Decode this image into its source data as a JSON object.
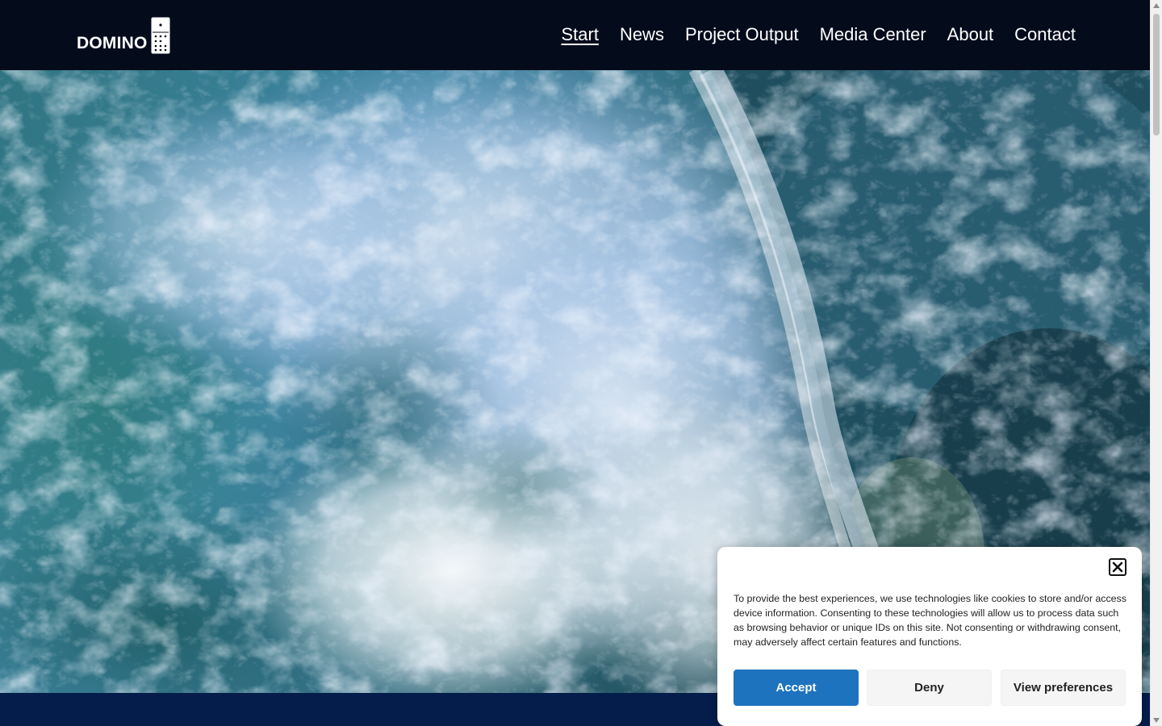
{
  "header": {
    "logo_text": "DOMINO",
    "nav": [
      {
        "label": "Start",
        "active": true
      },
      {
        "label": "News",
        "active": false
      },
      {
        "label": "Project Output",
        "active": false
      },
      {
        "label": "Media Center",
        "active": false
      },
      {
        "label": "About",
        "active": false
      },
      {
        "label": "Contact",
        "active": false
      }
    ]
  },
  "hero": {
    "image": "aerial ocean waves"
  },
  "cookie_banner": {
    "text": "To provide the best experiences, we use technologies like cookies to store and/or access device information. Consenting to these technologies will allow us to process data such as browsing behavior or unique IDs on this site. Not consenting or withdrawing consent, may adversely affect certain features and functions.",
    "accept_label": "Accept",
    "deny_label": "Deny",
    "preferences_label": "View preferences",
    "close_icon": "close-icon"
  },
  "colors": {
    "header_bg": "#040c1c",
    "accent": "#1e73be",
    "band": "#041d4a"
  }
}
